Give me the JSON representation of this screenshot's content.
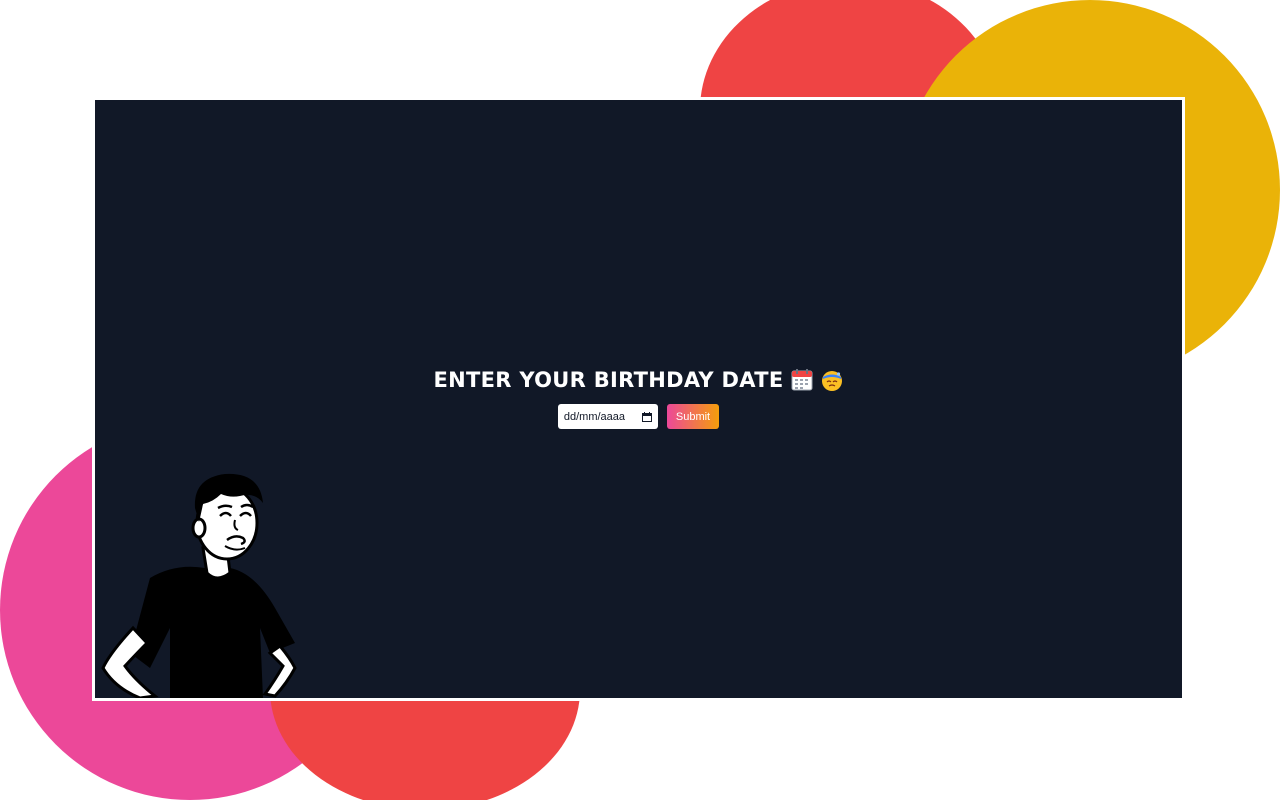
{
  "page": {
    "heading": "ENTER YOUR BIRTHDAY DATE",
    "heading_icons": [
      "calendar-icon",
      "face-with-headband-icon"
    ]
  },
  "form": {
    "date_placeholder": "dd/mm/aaaa",
    "date_value": "",
    "submit_label": "Submit"
  },
  "colors": {
    "panel_bg": "#111827",
    "blob_red": "#ef4444",
    "blob_yellow": "#eab308",
    "blob_pink": "#ec4899",
    "button_gradient_start": "#ec4899",
    "button_gradient_end": "#f59e0b"
  },
  "decorations": {
    "illustration": "thinking-man-illustration"
  }
}
